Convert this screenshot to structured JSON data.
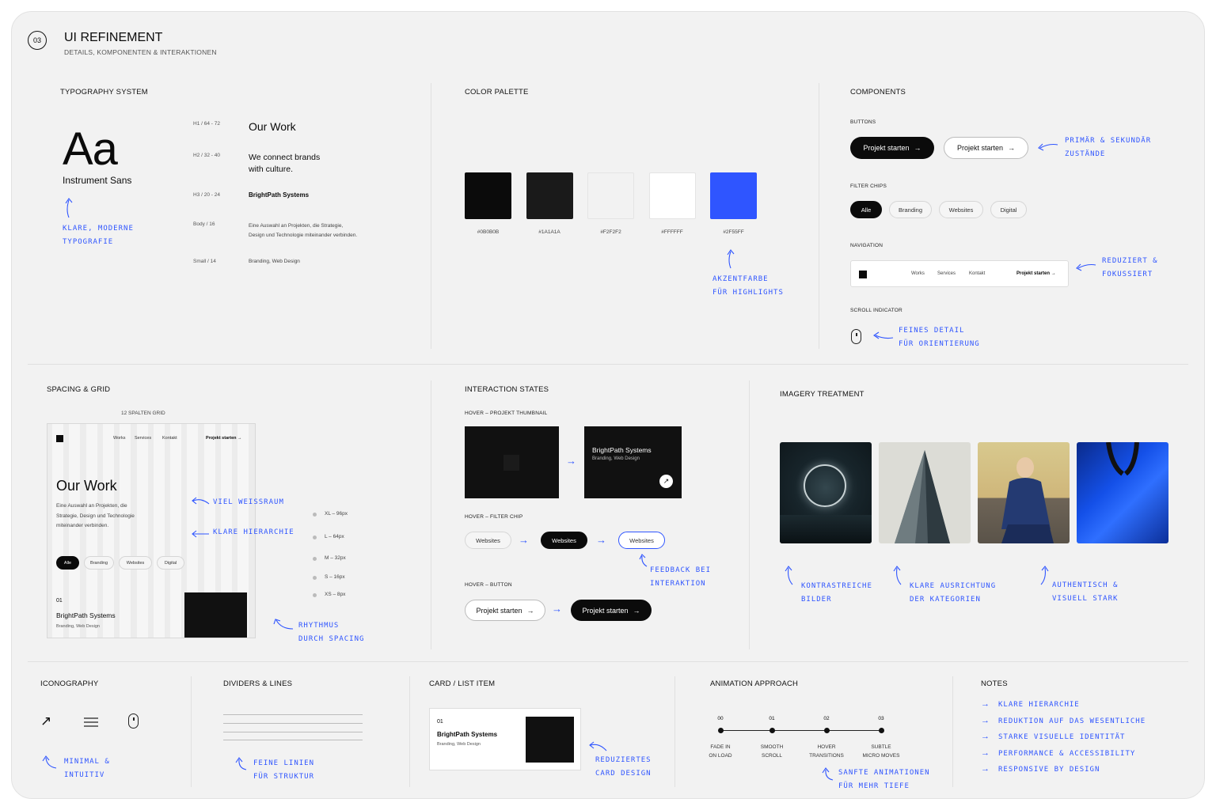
{
  "header": {
    "step": "03",
    "title": "UI REFINEMENT",
    "subtitle": "DETAILS, KOMPONENTEN & INTERAKTIONEN"
  },
  "typography": {
    "title": "TYPOGRAPHY SYSTEM",
    "specimen": "Aa",
    "font_name": "Instrument Sans",
    "note": [
      "KLARE, MODERNE",
      "TYPOGRAFIE"
    ],
    "rows": [
      {
        "label": "H1 / 64 - 72",
        "sample": "Our Work"
      },
      {
        "label": "H2 / 32 - 40",
        "sample": "We connect brands\nwith culture."
      },
      {
        "label": "H3 / 20 - 24",
        "sample": "BrightPath Systems"
      },
      {
        "label": "Body / 16",
        "sample": "Eine Auswahl an Projekten, die Strategie,\nDesign und Technologie miteinander verbinden."
      },
      {
        "label": "Small / 14",
        "sample": "Branding, Web Design"
      }
    ]
  },
  "palette": {
    "title": "COLOR PALETTE",
    "swatches": [
      {
        "hex": "#0B0B0B",
        "label": "#0B0B0B"
      },
      {
        "hex": "#1A1A1A",
        "label": "#1A1A1A"
      },
      {
        "hex": "#F2F2F2",
        "label": "#F2F2F2"
      },
      {
        "hex": "#FFFFFF",
        "label": "#FFFFFF"
      },
      {
        "hex": "#2F55FF",
        "label": "#2F55FF"
      }
    ],
    "note": [
      "AKZENTFARBE",
      "FÜR HIGHLIGHTS"
    ]
  },
  "components": {
    "title": "COMPONENTS",
    "buttons_label": "BUTTONS",
    "button_text": "Projekt starten",
    "buttons_note": [
      "PRIMÄR & SEKUNDÄR",
      "ZUSTÄNDE"
    ],
    "chips_label": "FILTER CHIPS",
    "chips": [
      "Alle",
      "Branding",
      "Websites",
      "Digital"
    ],
    "nav_label": "NAVIGATION",
    "nav_items": [
      "Works",
      "Services",
      "Kontakt"
    ],
    "nav_cta": "Projekt starten",
    "nav_note": [
      "REDUZIERT &",
      "FOKUSSIERT"
    ],
    "scroll_label": "SCROLL INDICATOR",
    "scroll_note": [
      "FEINES DETAIL",
      "FÜR ORIENTIERUNG"
    ]
  },
  "spacing": {
    "title": "SPACING & GRID",
    "grid_label": "12 SPALTEN GRID",
    "nav_items": [
      "Works",
      "Services",
      "Kontakt"
    ],
    "nav_cta": "Projekt starten",
    "heading": "Our Work",
    "body": "Eine Auswahl an Projekten, die\nStrategie, Design und Technologie\nmiteinander verbinden.",
    "chips": [
      "Alle",
      "Branding",
      "Websites",
      "Digital"
    ],
    "item_num": "01",
    "item_title": "BrightPath Systems",
    "item_sub": "Branding, Web Design",
    "notes": {
      "whitespace": "VIEL WEISSRAUM",
      "hierarchy": "KLARE HIERARCHIE",
      "rhythm": [
        "RHYTHMUS",
        "DURCH SPACING"
      ]
    },
    "scale": [
      "XL – 96px",
      "L – 64px",
      "M – 32px",
      "S – 16px",
      "XS – 8px"
    ]
  },
  "interaction": {
    "title": "INTERACTION STATES",
    "thumb_label": "HOVER – PROJEKT THUMBNAIL",
    "thumb_title": "BrightPath Systems",
    "thumb_sub": "Branding, Web Design",
    "chip_label": "HOVER – FILTER CHIP",
    "chip_text": "Websites",
    "chip_note": [
      "FEEDBACK BEI",
      "INTERAKTION"
    ],
    "button_label": "HOVER – BUTTON",
    "button_text": "Projekt starten"
  },
  "imagery": {
    "title": "IMAGERY TREATMENT",
    "notes": [
      [
        "KONTRASTREICHE",
        "BILDER"
      ],
      [
        "KLARE AUSRICHTUNG",
        "DER KATEGORIEN"
      ],
      [
        "AUTHENTISCH &",
        "VISUELL STARK"
      ]
    ]
  },
  "iconography": {
    "title": "ICONOGRAPHY",
    "note": [
      "MINIMAL &",
      "INTUITIV"
    ]
  },
  "dividers": {
    "title": "DIVIDERS & LINES",
    "note": [
      "FEINE LINIEN",
      "FÜR STRUKTUR"
    ]
  },
  "card": {
    "title": "CARD / LIST ITEM",
    "num": "01",
    "item_title": "BrightPath Systems",
    "item_sub": "Branding, Web Design",
    "note": [
      "REDUZIERTES",
      "CARD DESIGN"
    ]
  },
  "animation": {
    "title": "ANIMATION APPROACH",
    "steps": [
      {
        "num": "00",
        "label": [
          "FADE IN",
          "ON LOAD"
        ]
      },
      {
        "num": "01",
        "label": [
          "SMOOTH",
          "SCROLL"
        ]
      },
      {
        "num": "02",
        "label": [
          "HOVER",
          "TRANSITIONS"
        ]
      },
      {
        "num": "03",
        "label": [
          "SUBTLE",
          "MICRO MOVES"
        ]
      }
    ],
    "note": [
      "SANFTE ANIMATIONEN",
      "FÜR MEHR TIEFE"
    ]
  },
  "notes": {
    "title": "NOTES",
    "items": [
      "KLARE HIERARCHIE",
      "REDUKTION AUF DAS WESENTLICHE",
      "STARKE VISUELLE IDENTITÄT",
      "PERFORMANCE & ACCESSIBILITY",
      "RESPONSIVE BY DESIGN"
    ]
  },
  "colors": {
    "accent": "#2F55FF",
    "ink": "#0B0B0B",
    "surface": "#F2F2F2"
  }
}
